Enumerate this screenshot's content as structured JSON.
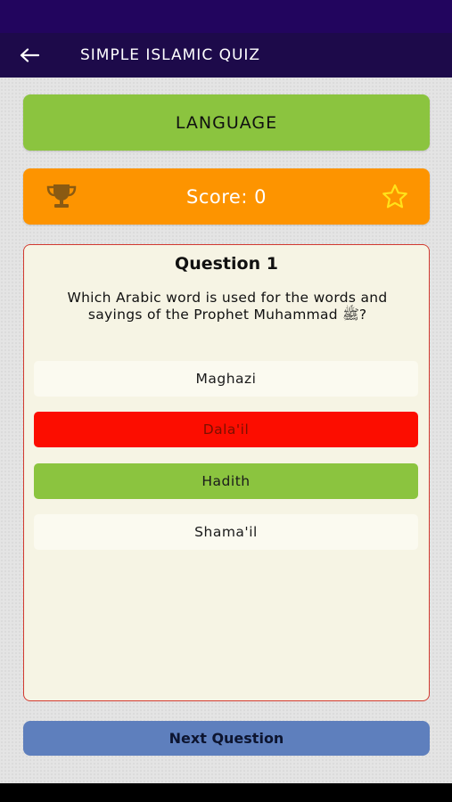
{
  "app_bar": {
    "title": "SIMPLE ISLAMIC QUIZ",
    "back_icon": "arrow-left-icon"
  },
  "language_button": {
    "label": "LANGUAGE"
  },
  "score": {
    "label": "Score: 0",
    "left_icon": "trophy-icon",
    "right_icon": "star-icon"
  },
  "question": {
    "number_label": "Question 1",
    "text": "Which Arabic word is used for the words and sayings of the Prophet Muhammad ﷺ?",
    "options": [
      {
        "label": "Maghazi",
        "state": "neutral"
      },
      {
        "label": "Dala'il",
        "state": "wrong"
      },
      {
        "label": "Hadith",
        "state": "correct"
      },
      {
        "label": "Shama'il",
        "state": "neutral"
      }
    ]
  },
  "next_button": {
    "label": "Next Question"
  },
  "colors": {
    "app_bar": "#1d0a4a",
    "status_bar": "#22055e",
    "language_button": "#8bc43f",
    "score_bar": "#fd9400",
    "wrong_option": "#fc0d00",
    "correct_option": "#8bc43f",
    "next_button": "#5e7fbd",
    "card_border": "#d23a30"
  }
}
